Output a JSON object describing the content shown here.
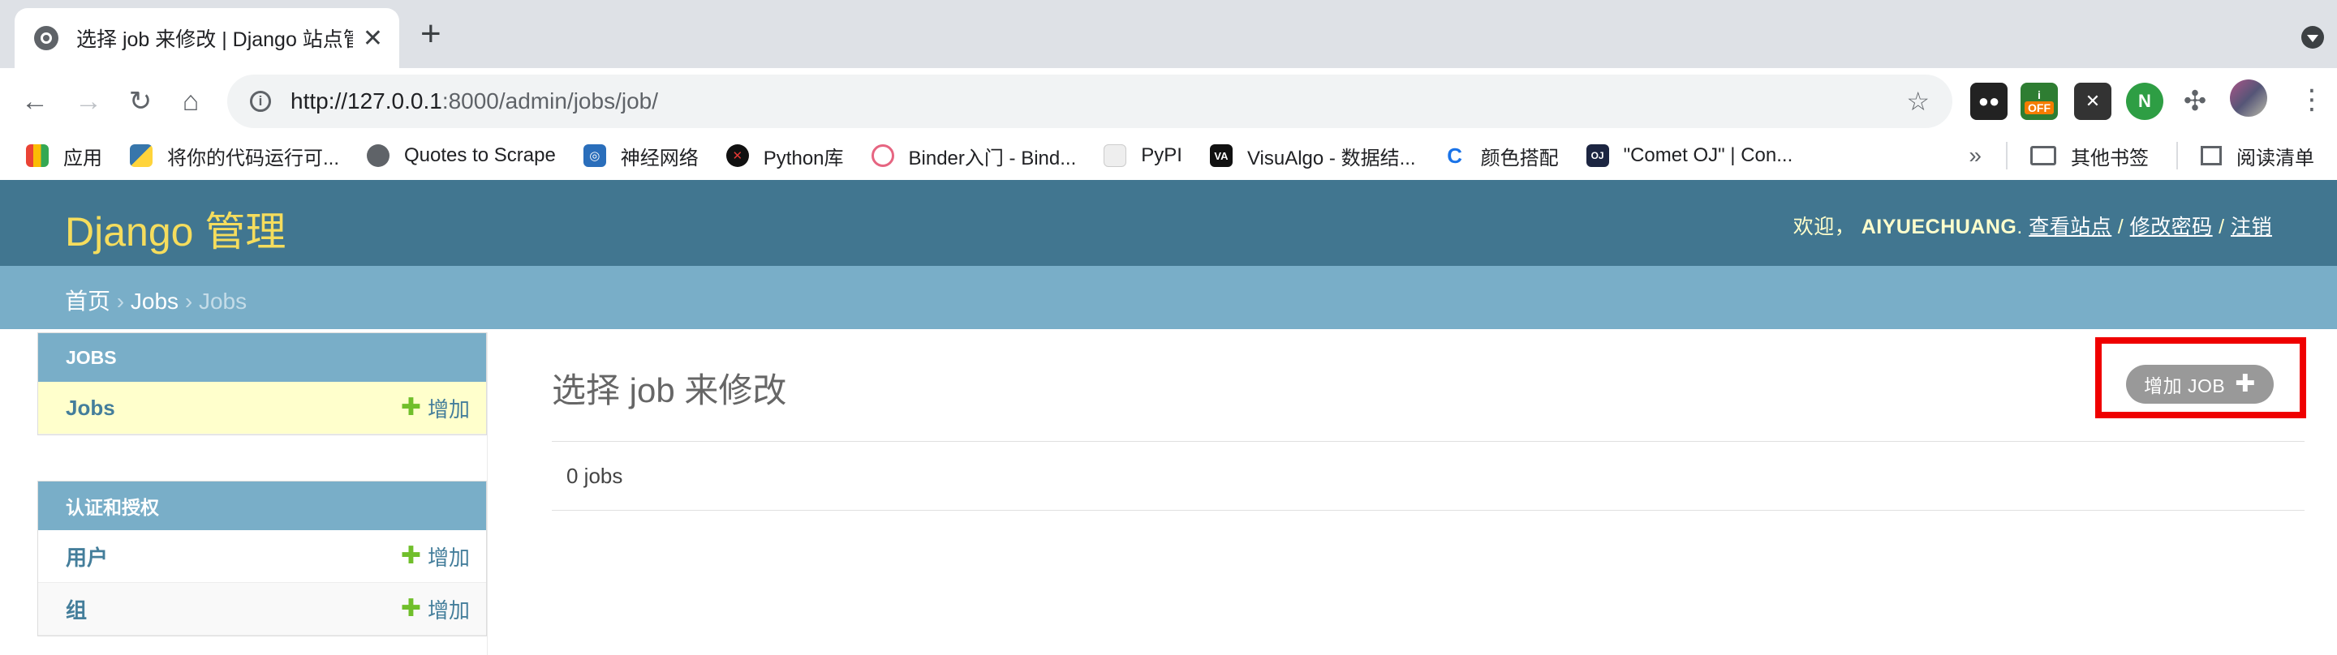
{
  "browser": {
    "tab_title": "选择 job 来修改 | Django 站点管",
    "tab_close": "✕",
    "new_tab": "+",
    "url_host": "http://127.0.0.1",
    "url_path": ":8000/admin/jobs/job/",
    "ext_off_label": "OFF",
    "bookmarks": [
      {
        "label": "应用",
        "icon": "apps-grid-icon",
        "color": "#ea4335"
      },
      {
        "label": "将你的代码运行可...",
        "icon": "python-icon",
        "color": "#3776ab"
      },
      {
        "label": "Quotes to Scrape",
        "icon": "globe-icon",
        "color": "#5f6368"
      },
      {
        "label": "神经网络",
        "icon": "spiral-icon",
        "color": "#2a6ebb"
      },
      {
        "label": "Python库",
        "icon": "x-circle-icon",
        "color": "#c00"
      },
      {
        "label": "Binder入门 - Bind...",
        "icon": "binder-icon",
        "color": "#e66581"
      },
      {
        "label": "PyPI",
        "icon": "cube-icon",
        "color": "#d0d0d0"
      },
      {
        "label": "VisuAlgo - 数据结...",
        "icon": "visualgo-icon",
        "color": "#111"
      },
      {
        "label": "颜色搭配",
        "icon": "c-logo-icon",
        "color": "#1a73e8"
      },
      {
        "label": "\"Comet OJ\" | Con...",
        "icon": "oj-icon",
        "color": "#1c2541"
      }
    ],
    "bookmarks_overflow": "»",
    "other_bookmarks": "其他书签",
    "reading_list": "阅读清单"
  },
  "admin": {
    "branding": "Django 管理",
    "welcome": "欢迎，",
    "username": "AIYUECHUANG",
    "view_site": "查看站点",
    "change_password": "修改密码",
    "logout": "注销",
    "slash": " / ",
    "breadcrumb_home": "首页",
    "breadcrumb_sep": " › ",
    "breadcrumb_app": "Jobs",
    "breadcrumb_current": "Jobs"
  },
  "sidebar": {
    "modules": [
      {
        "caption": "JOBS",
        "rows": [
          {
            "model": "Jobs",
            "add": "增加"
          }
        ]
      },
      {
        "caption": "认证和授权",
        "rows": [
          {
            "model": "用户",
            "add": "增加"
          },
          {
            "model": "组",
            "add": "增加"
          }
        ]
      }
    ]
  },
  "content": {
    "title": "选择 job 来修改",
    "add_button": "增加 JOB",
    "add_plus": "✚",
    "result_count": "0 jobs"
  }
}
